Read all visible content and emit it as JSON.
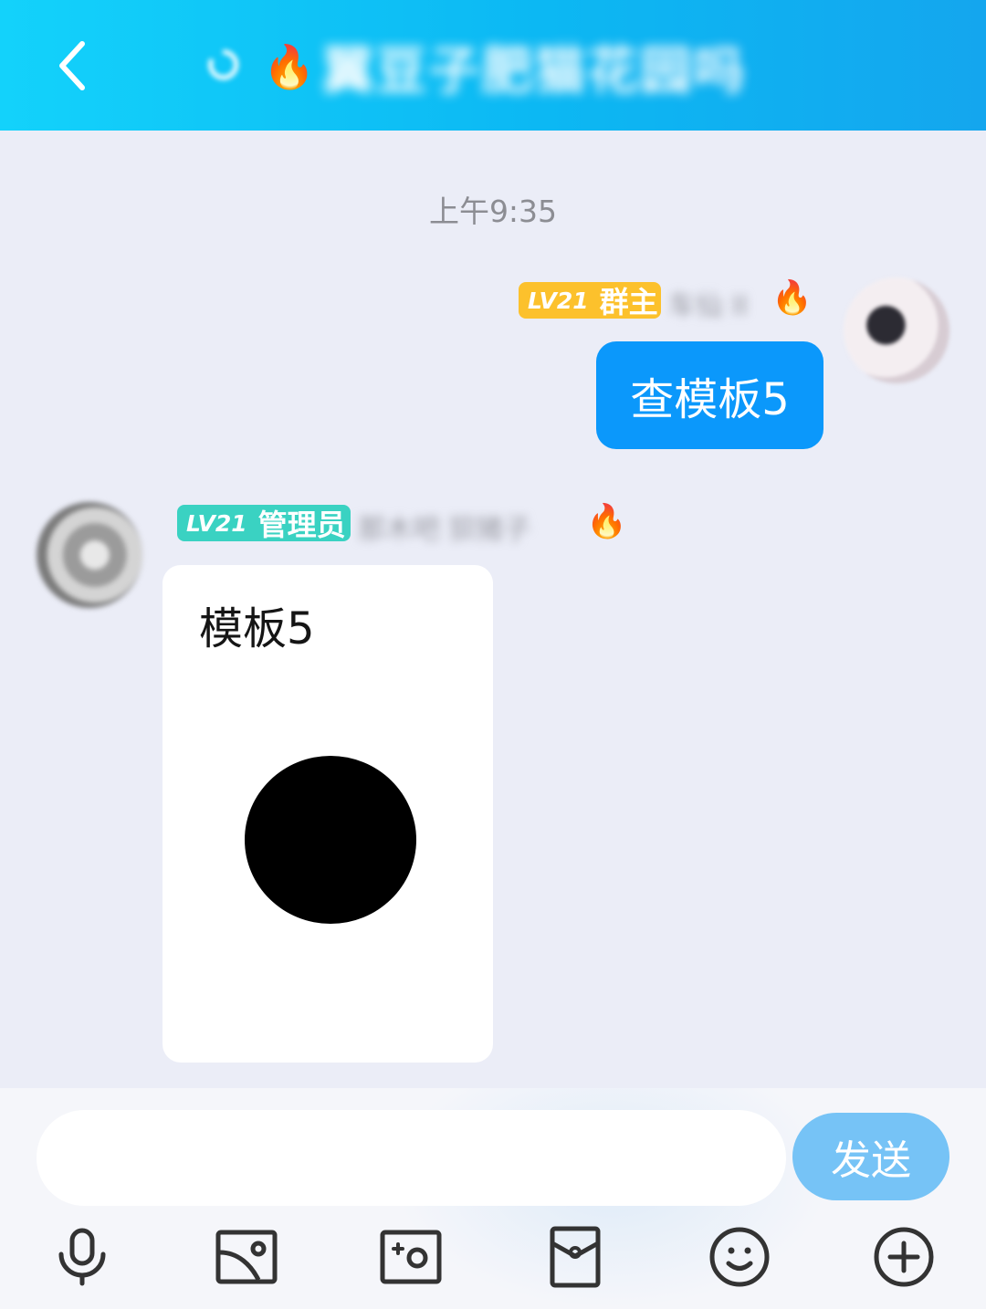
{
  "header": {
    "back_icon": "chevron-left-icon",
    "title_prefix_emoji": "🔥",
    "title": "翼豆子肥猫花园吗"
  },
  "chat": {
    "timestamp": "上午9:35",
    "messages": [
      {
        "side": "right",
        "level": "LV21",
        "role": "群主",
        "nickname": "车仙 II",
        "fire_emoji": "🔥",
        "text": "查模板5"
      },
      {
        "side": "left",
        "level": "LV21",
        "role": "管理员",
        "nickname": "那木吧  狈猪子",
        "fire_emoji": "🔥",
        "card": {
          "title": "模板5"
        }
      }
    ]
  },
  "composer": {
    "placeholder": "",
    "send_label": "发送"
  },
  "toolbar": [
    "microphone-icon",
    "image-icon",
    "camera-icon",
    "red-packet-icon",
    "emoji-icon",
    "plus-icon"
  ],
  "colors": {
    "header_gradient_start": "#13d2fb",
    "header_gradient_end": "#14a6ee",
    "outgoing_bubble": "#0b98fb",
    "owner_badge": "#fcc12c",
    "admin_badge": "#3ad2c2",
    "send_button": "#76c3f6",
    "background": "#ebedf7"
  }
}
